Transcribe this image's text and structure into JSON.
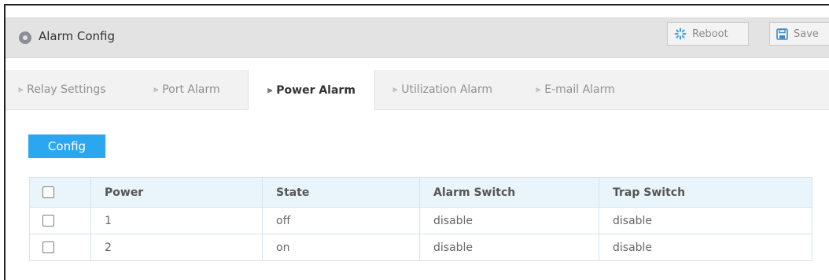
{
  "header": {
    "title": "Alarm Config",
    "title_icon": "location-pin-icon",
    "reboot_label": "Reboot",
    "reboot_icon": "spinner-icon",
    "save_label": "Save",
    "save_icon": "floppy-disk-icon"
  },
  "tabs": [
    {
      "label": "Relay Settings",
      "active": false
    },
    {
      "label": "Port Alarm",
      "active": false
    },
    {
      "label": "Power Alarm",
      "active": true
    },
    {
      "label": "Utilization Alarm",
      "active": false
    },
    {
      "label": "E-mail Alarm",
      "active": false
    }
  ],
  "config_button": {
    "label": "Config"
  },
  "table": {
    "columns": [
      "Power",
      "State",
      "Alarm Switch",
      "Trap Switch"
    ],
    "rows": [
      {
        "power": "1",
        "state": "off",
        "alarm_switch": "disable",
        "trap_switch": "disable",
        "checked": false
      },
      {
        "power": "2",
        "state": "on",
        "alarm_switch": "disable",
        "trap_switch": "disable",
        "checked": false
      }
    ]
  },
  "colors": {
    "accent": "#2aa7f0",
    "header_bg": "#e3e3e3",
    "table_header_bg": "#e9f4fb"
  }
}
